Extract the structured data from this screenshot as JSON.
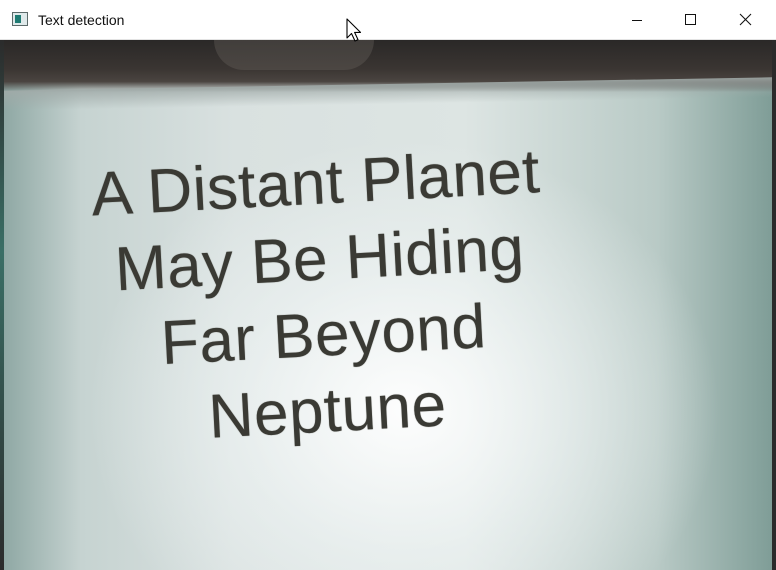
{
  "window": {
    "title": "Text detection",
    "icon": "opencv-window-icon",
    "controls": {
      "minimize": "minimize-icon",
      "maximize": "maximize-icon",
      "close": "close-icon"
    }
  },
  "image": {
    "lines": [
      "A Distant Planet",
      "May Be Hiding",
      "Far Beyond",
      "Neptune"
    ]
  },
  "colors": {
    "titlebar": "#ffffff",
    "text": "#3a3a34",
    "paper": "#dde5e3"
  }
}
